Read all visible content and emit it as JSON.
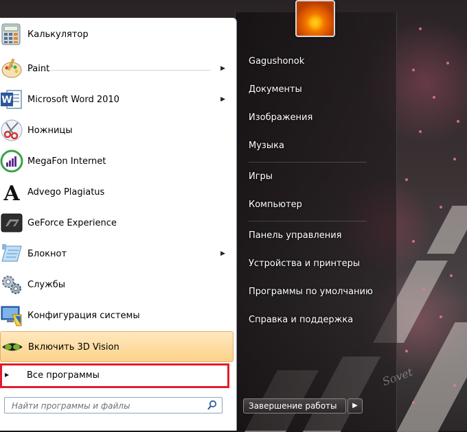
{
  "user": {
    "name": "Gagushonok"
  },
  "programs": [
    {
      "label": "Калькулятор",
      "icon": "calculator-icon",
      "has_submenu": false
    },
    {
      "label": "Paint",
      "icon": "paint-icon",
      "has_submenu": true
    },
    {
      "label": "Microsoft Word 2010",
      "icon": "word-icon",
      "has_submenu": true
    },
    {
      "label": "Ножницы",
      "icon": "scissors-icon",
      "has_submenu": false
    },
    {
      "label": "MegaFon Internet",
      "icon": "megafon-icon",
      "has_submenu": false
    },
    {
      "label": "Advego Plagiatus",
      "icon": "advego-icon",
      "has_submenu": false
    },
    {
      "label": "GeForce Experience",
      "icon": "geforce-icon",
      "has_submenu": false
    },
    {
      "label": "Блокнот",
      "icon": "notepad-icon",
      "has_submenu": true
    },
    {
      "label": "Службы",
      "icon": "gears-icon",
      "has_submenu": false
    },
    {
      "label": "Конфигурация системы",
      "icon": "system-config-icon",
      "has_submenu": false
    },
    {
      "label": "Включить 3D Vision",
      "icon": "3d-vision-icon",
      "has_submenu": false
    }
  ],
  "all_programs": {
    "label": "Все программы"
  },
  "search": {
    "placeholder": "Найти программы и файлы"
  },
  "right_items": [
    "Документы",
    "Изображения",
    "Музыка",
    "Игры",
    "Компьютер",
    "Панель управления",
    "Устройства и принтеры",
    "Программы по умолчанию",
    "Справка и поддержка"
  ],
  "shutdown": {
    "label": "Завершение работы",
    "arrow": "▶"
  },
  "watermark": "Sovet",
  "colors": {
    "highlight_border": "#e21c2a",
    "hover_bg": "#fcd28a"
  }
}
